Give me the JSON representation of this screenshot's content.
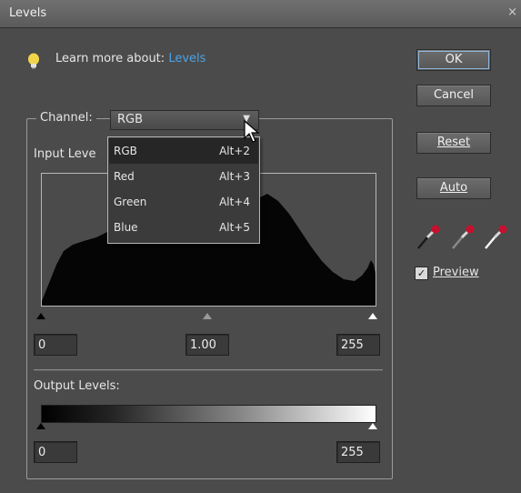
{
  "window": {
    "title": "Levels",
    "close": "×"
  },
  "learn": {
    "prefix": "Learn more about:",
    "link": "Levels"
  },
  "buttons": {
    "ok": "OK",
    "cancel": "Cancel",
    "reset": "Reset",
    "auto": "Auto"
  },
  "channel": {
    "label": "Channel:",
    "value": "RGB"
  },
  "input_levels": {
    "label": "Input Leve",
    "black": "0",
    "gamma": "1.00",
    "white": "255"
  },
  "output_levels": {
    "label": "Output Levels:",
    "black": "0",
    "white": "255"
  },
  "preview": {
    "label": "Preview",
    "checked": true
  },
  "dropdown": {
    "items": [
      {
        "label": "RGB",
        "shortcut": "Alt+2",
        "selected": true
      },
      {
        "label": "Red",
        "shortcut": "Alt+3"
      },
      {
        "label": "Green",
        "shortcut": "Alt+4"
      },
      {
        "label": "Blue",
        "shortcut": "Alt+5"
      }
    ]
  },
  "eyedroppers": [
    "black-eyedropper-icon",
    "gray-eyedropper-icon",
    "white-eyedropper-icon"
  ],
  "colors": {
    "accent_link": "#4aa3e6",
    "dialog_bg": "#4b4b4b",
    "dropper_red": "#c8102e"
  }
}
